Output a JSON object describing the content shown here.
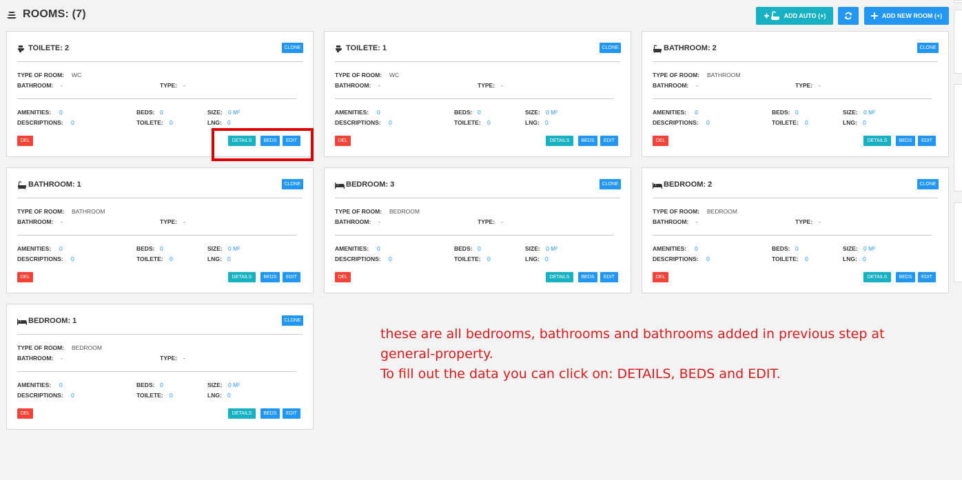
{
  "header": {
    "title": "ROOMS: (7)",
    "icon": "stacked-layers-icon",
    "buttons": {
      "add_auto": "ADD AUTO (+)",
      "add_new": "ADD NEW ROOM (+)",
      "refresh_icon": "refresh-icon"
    }
  },
  "labels": {
    "type_of_room": "TYPE OF ROOM:",
    "bathroom": "BATHROOM:",
    "type": "TYPE:",
    "amenities": "AMENITIES:",
    "descriptions": "DESCRIPTIONS:",
    "beds": "BEDS:",
    "toilete": "TOILETE:",
    "size": "SIZE:",
    "lng": "LNG:",
    "clone": "CLONE",
    "del": "DEL",
    "details": "DETAILS",
    "beds_btn": "BEDS",
    "edit": "EDIT"
  },
  "rooms": [
    {
      "title": "TOILETE: 2",
      "icon": "toilet-icon",
      "type_of_room": "WC",
      "bathroom": "-",
      "type": "-",
      "amenities": "0",
      "descriptions": "0",
      "beds": "0",
      "toilete": "0",
      "size": "0 M²",
      "lng": "0"
    },
    {
      "title": "TOILETE: 1",
      "icon": "toilet-icon",
      "type_of_room": "WC",
      "bathroom": "-",
      "type": "-",
      "amenities": "0",
      "descriptions": "0",
      "beds": "0",
      "toilete": "0",
      "size": "0 M²",
      "lng": "0"
    },
    {
      "title": "BATHROOM: 2",
      "icon": "bathtub-icon",
      "type_of_room": "BATHROOM",
      "bathroom": "-",
      "type": "-",
      "amenities": "0",
      "descriptions": "0",
      "beds": "0",
      "toilete": "0",
      "size": "0 M²",
      "lng": "0"
    },
    {
      "title": "BATHROOM: 1",
      "icon": "bathtub-icon",
      "type_of_room": "BATHROOM",
      "bathroom": "-",
      "type": "-",
      "amenities": "0",
      "descriptions": "0",
      "beds": "0",
      "toilete": "0",
      "size": "0 M²",
      "lng": "0"
    },
    {
      "title": "BEDROOM: 3",
      "icon": "bed-icon",
      "type_of_room": "BEDROOM",
      "bathroom": "-",
      "type": "-",
      "amenities": "0",
      "descriptions": "0",
      "beds": "0",
      "toilete": "0",
      "size": "0 M²",
      "lng": "0"
    },
    {
      "title": "BEDROOM: 2",
      "icon": "bed-icon",
      "type_of_room": "BEDROOM",
      "bathroom": "-",
      "type": "-",
      "amenities": "0",
      "descriptions": "0",
      "beds": "0",
      "toilete": "0",
      "size": "0 M²",
      "lng": "0"
    },
    {
      "title": "BEDROOM: 1",
      "icon": "bed-icon",
      "type_of_room": "BEDROOM",
      "bathroom": "-",
      "type": "-",
      "amenities": "0",
      "descriptions": "0",
      "beds": "0",
      "toilete": "0",
      "size": "0 M²",
      "lng": "0"
    }
  ],
  "annotation": {
    "line1": "these are all  bedrooms, bathrooms and bathrooms added in previous step at",
    "line2": "general-property.",
    "line3": "To fill out the data you can click on: DETAILS, BEDS and EDIT."
  },
  "colors": {
    "primary": "#2196f3",
    "info": "#17b1c4",
    "danger": "#f44336",
    "annotation": "#e01818"
  }
}
